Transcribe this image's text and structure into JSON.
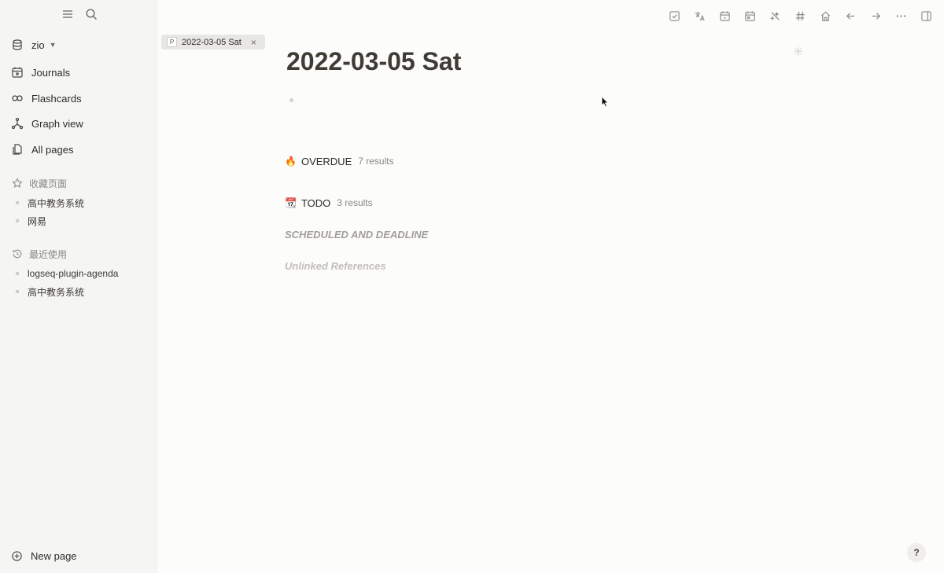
{
  "sidebar": {
    "graph_name": "zio",
    "nav": [
      {
        "label": "Journals",
        "icon": "calendar-icon"
      },
      {
        "label": "Flashcards",
        "icon": "infinity-icon"
      },
      {
        "label": "Graph view",
        "icon": "graph-icon"
      },
      {
        "label": "All pages",
        "icon": "pages-icon"
      }
    ],
    "favorites": {
      "title": "收藏页面",
      "items": [
        "高中教务系统",
        "网易"
      ]
    },
    "recent": {
      "title": "最近使用",
      "items": [
        "logseq-plugin-agenda",
        "高中教务系统"
      ]
    },
    "new_page_label": "New page"
  },
  "tab": {
    "badge": "P",
    "label": "2022-03-05 Sat",
    "close": "×"
  },
  "page": {
    "title": "2022-03-05 Sat",
    "queries": [
      {
        "emoji": "🔥",
        "label": "OVERDUE",
        "count": "7 results"
      },
      {
        "emoji": "📆",
        "label": "TODO",
        "count": "3 results"
      }
    ],
    "scheduled_title": "SCHEDULED AND DEADLINE",
    "unlinked_title": "Unlinked References"
  },
  "help": {
    "label": "?"
  },
  "colors": {
    "sidebar_bg": "#f5f5f4",
    "main_bg": "#fcfcfb",
    "text": "#433f38",
    "muted": "#8c8883"
  }
}
